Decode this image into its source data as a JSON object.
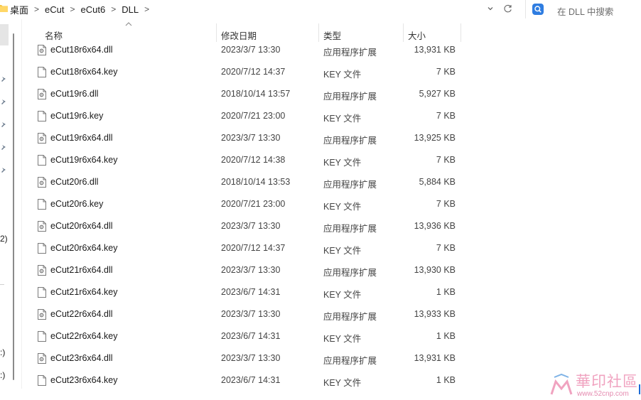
{
  "address_bar": {
    "breadcrumbs": [
      "桌面",
      "eCut",
      "eCut6",
      "DLL"
    ],
    "separator": ">"
  },
  "search": {
    "placeholder": "在 DLL 中搜索"
  },
  "nav": {
    "fragments": [
      "2)",
      ":)",
      ":)"
    ]
  },
  "columns": {
    "name": "名称",
    "date": "修改日期",
    "type": "类型",
    "size": "大小"
  },
  "files": [
    {
      "name": "eCut18r6x64.dll",
      "date": "2023/3/7 13:30",
      "type": "应用程序扩展",
      "size": "13,931 KB",
      "icon": "dll-file-icon"
    },
    {
      "name": "eCut18r6x64.key",
      "date": "2020/7/12 14:37",
      "type": "KEY 文件",
      "size": "7 KB",
      "icon": "blank-file-icon"
    },
    {
      "name": "eCut19r6.dll",
      "date": "2018/10/14 13:57",
      "type": "应用程序扩展",
      "size": "5,927 KB",
      "icon": "dll-file-icon"
    },
    {
      "name": "eCut19r6.key",
      "date": "2020/7/21 23:00",
      "type": "KEY 文件",
      "size": "7 KB",
      "icon": "blank-file-icon"
    },
    {
      "name": "eCut19r6x64.dll",
      "date": "2023/3/7 13:30",
      "type": "应用程序扩展",
      "size": "13,925 KB",
      "icon": "dll-file-icon"
    },
    {
      "name": "eCut19r6x64.key",
      "date": "2020/7/12 14:38",
      "type": "KEY 文件",
      "size": "7 KB",
      "icon": "blank-file-icon"
    },
    {
      "name": "eCut20r6.dll",
      "date": "2018/10/14 13:53",
      "type": "应用程序扩展",
      "size": "5,884 KB",
      "icon": "dll-file-icon"
    },
    {
      "name": "eCut20r6.key",
      "date": "2020/7/21 23:00",
      "type": "KEY 文件",
      "size": "7 KB",
      "icon": "blank-file-icon"
    },
    {
      "name": "eCut20r6x64.dll",
      "date": "2023/3/7 13:30",
      "type": "应用程序扩展",
      "size": "13,936 KB",
      "icon": "dll-file-icon"
    },
    {
      "name": "eCut20r6x64.key",
      "date": "2020/7/12 14:37",
      "type": "KEY 文件",
      "size": "7 KB",
      "icon": "blank-file-icon"
    },
    {
      "name": "eCut21r6x64.dll",
      "date": "2023/3/7 13:30",
      "type": "应用程序扩展",
      "size": "13,930 KB",
      "icon": "dll-file-icon"
    },
    {
      "name": "eCut21r6x64.key",
      "date": "2023/6/7 14:31",
      "type": "KEY 文件",
      "size": "1 KB",
      "icon": "blank-file-icon"
    },
    {
      "name": "eCut22r6x64.dll",
      "date": "2023/3/7 13:30",
      "type": "应用程序扩展",
      "size": "13,933 KB",
      "icon": "dll-file-icon"
    },
    {
      "name": "eCut22r6x64.key",
      "date": "2023/6/7 14:31",
      "type": "KEY 文件",
      "size": "1 KB",
      "icon": "blank-file-icon"
    },
    {
      "name": "eCut23r6x64.dll",
      "date": "2023/3/7 13:30",
      "type": "应用程序扩展",
      "size": "13,931 KB",
      "icon": "dll-file-icon"
    },
    {
      "name": "eCut23r6x64.key",
      "date": "2023/6/7 14:31",
      "type": "KEY 文件",
      "size": "1 KB",
      "icon": "blank-file-icon"
    }
  ],
  "watermark": {
    "text": "華印社區",
    "url": "www.52cnp.com"
  },
  "colors": {
    "accent": "#2f7de1",
    "watermark": "#f0a3c0"
  }
}
